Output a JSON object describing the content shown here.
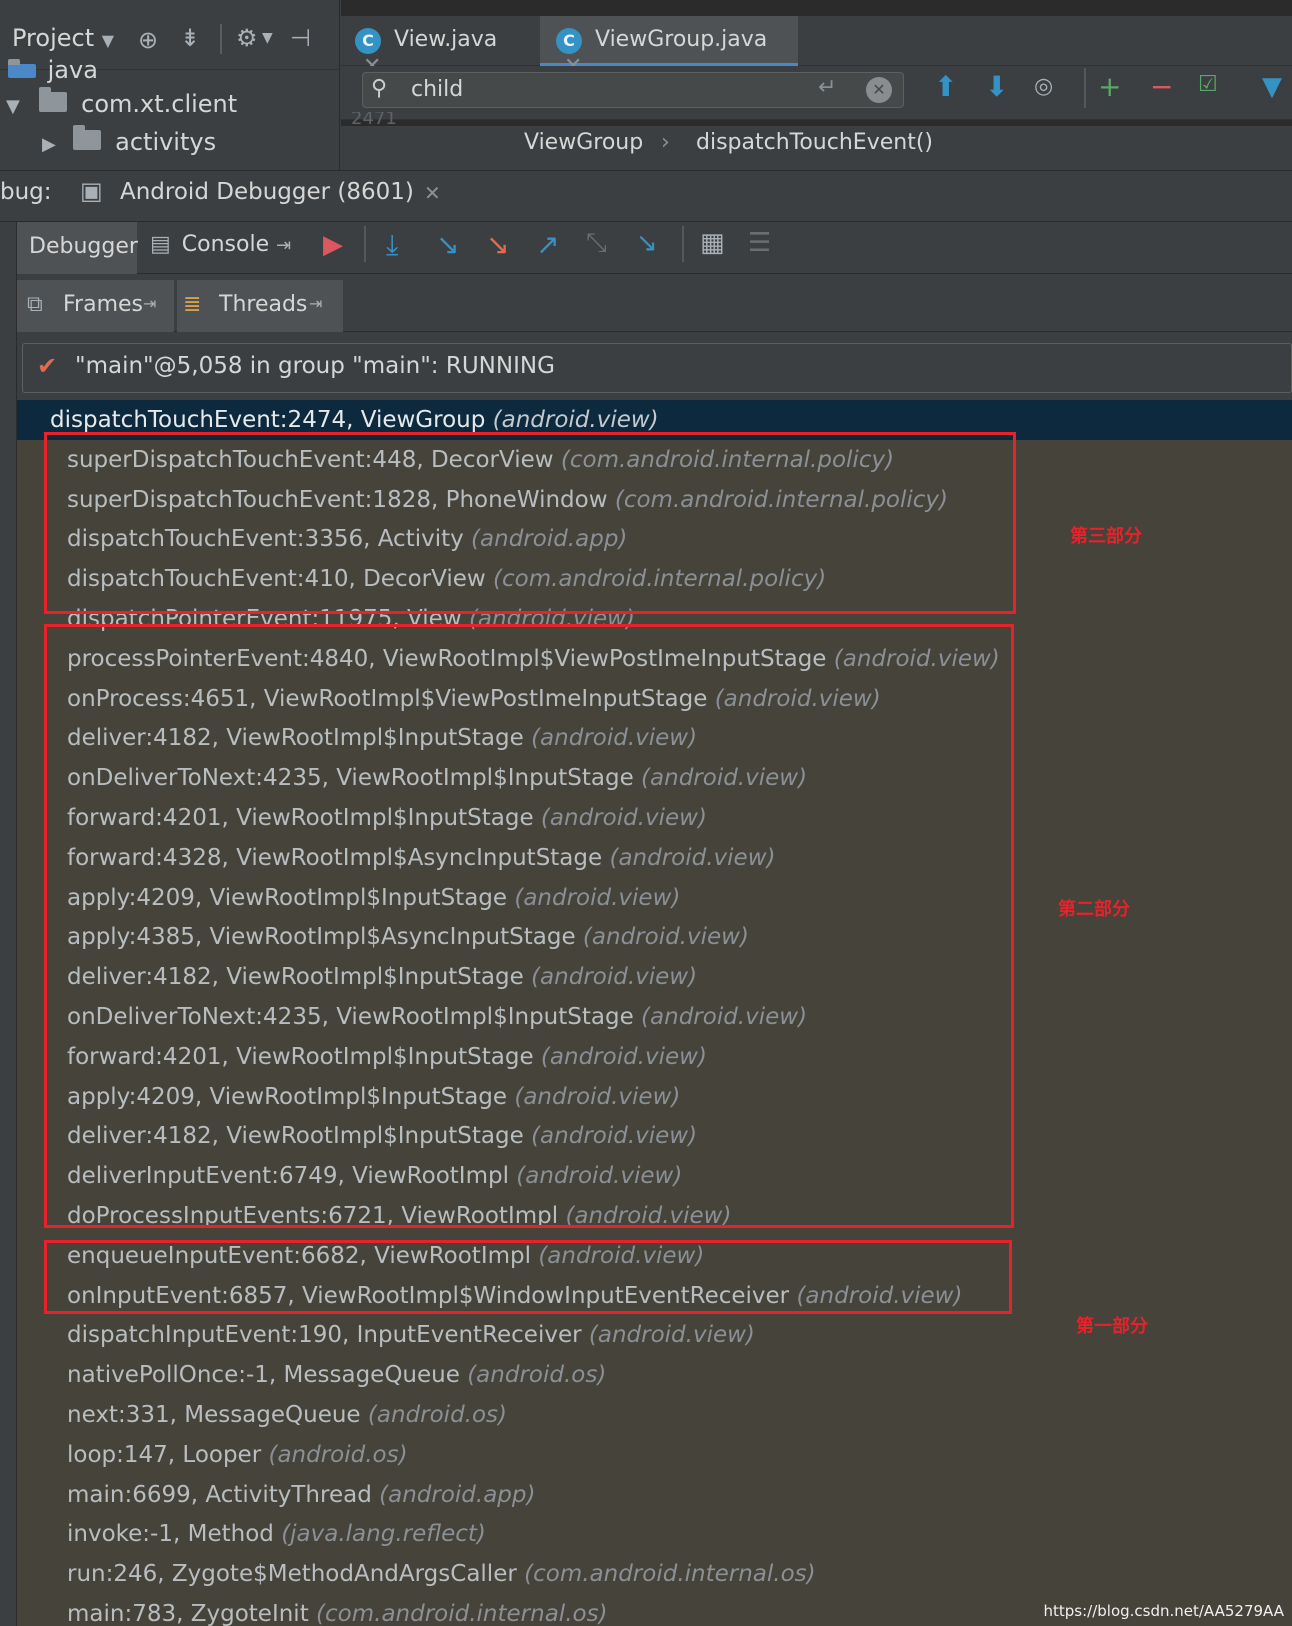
{
  "project_panel": {
    "title": "Project",
    "tree": [
      {
        "label": "java"
      },
      {
        "label": "com.xt.client"
      },
      {
        "label": "activitys"
      }
    ]
  },
  "editor": {
    "tabs": [
      {
        "label": "View.java",
        "icon": "C"
      },
      {
        "label": "ViewGroup.java",
        "icon": "C"
      }
    ],
    "search": {
      "value": "child"
    },
    "breadcrumbs": [
      "ViewGroup",
      "dispatchTouchEvent()"
    ],
    "gutter_fragment": "2471"
  },
  "debug": {
    "window_label": "bug:",
    "session_title": "Android Debugger (8601)",
    "tabs": {
      "debugger": "Debugger",
      "console": "Console"
    },
    "subtabs": {
      "frames": "Frames",
      "threads": "Threads"
    },
    "thread": "\"main\"@5,058 in group \"main\": RUNNING",
    "frames": [
      {
        "method": "dispatchTouchEvent:2474, ViewGroup",
        "pkg": "(android.view)",
        "selected": true
      },
      {
        "method": "superDispatchTouchEvent:448, DecorView",
        "pkg": "(com.android.internal.policy)"
      },
      {
        "method": "superDispatchTouchEvent:1828, PhoneWindow",
        "pkg": "(com.android.internal.policy)"
      },
      {
        "method": "dispatchTouchEvent:3356, Activity",
        "pkg": "(android.app)"
      },
      {
        "method": "dispatchTouchEvent:410, DecorView",
        "pkg": "(com.android.internal.policy)"
      },
      {
        "method": "dispatchPointerEvent:11975, View",
        "pkg": "(android.view)"
      },
      {
        "method": "processPointerEvent:4840, ViewRootImpl$ViewPostImeInputStage",
        "pkg": "(android.view)"
      },
      {
        "method": "onProcess:4651, ViewRootImpl$ViewPostImeInputStage",
        "pkg": "(android.view)"
      },
      {
        "method": "deliver:4182, ViewRootImpl$InputStage",
        "pkg": "(android.view)"
      },
      {
        "method": "onDeliverToNext:4235, ViewRootImpl$InputStage",
        "pkg": "(android.view)"
      },
      {
        "method": "forward:4201, ViewRootImpl$InputStage",
        "pkg": "(android.view)"
      },
      {
        "method": "forward:4328, ViewRootImpl$AsyncInputStage",
        "pkg": "(android.view)"
      },
      {
        "method": "apply:4209, ViewRootImpl$InputStage",
        "pkg": "(android.view)"
      },
      {
        "method": "apply:4385, ViewRootImpl$AsyncInputStage",
        "pkg": "(android.view)"
      },
      {
        "method": "deliver:4182, ViewRootImpl$InputStage",
        "pkg": "(android.view)"
      },
      {
        "method": "onDeliverToNext:4235, ViewRootImpl$InputStage",
        "pkg": "(android.view)"
      },
      {
        "method": "forward:4201, ViewRootImpl$InputStage",
        "pkg": "(android.view)"
      },
      {
        "method": "apply:4209, ViewRootImpl$InputStage",
        "pkg": "(android.view)"
      },
      {
        "method": "deliver:4182, ViewRootImpl$InputStage",
        "pkg": "(android.view)"
      },
      {
        "method": "deliverInputEvent:6749, ViewRootImpl",
        "pkg": "(android.view)"
      },
      {
        "method": "doProcessInputEvents:6721, ViewRootImpl",
        "pkg": "(android.view)"
      },
      {
        "method": "enqueueInputEvent:6682, ViewRootImpl",
        "pkg": "(android.view)"
      },
      {
        "method": "onInputEvent:6857, ViewRootImpl$WindowInputEventReceiver",
        "pkg": "(android.view)"
      },
      {
        "method": "dispatchInputEvent:190, InputEventReceiver",
        "pkg": "(android.view)"
      },
      {
        "method": "nativePollOnce:-1, MessageQueue",
        "pkg": "(android.os)"
      },
      {
        "method": "next:331, MessageQueue",
        "pkg": "(android.os)"
      },
      {
        "method": "loop:147, Looper",
        "pkg": "(android.os)"
      },
      {
        "method": "main:6699, ActivityThread",
        "pkg": "(android.app)"
      },
      {
        "method": "invoke:-1, Method",
        "pkg": "(java.lang.reflect)"
      },
      {
        "method": "run:246, Zygote$MethodAndArgsCaller",
        "pkg": "(com.android.internal.os)"
      },
      {
        "method": "main:783, ZygoteInit",
        "pkg": "(com.android.internal.os)"
      }
    ]
  },
  "annotations": {
    "part3": "第三部分",
    "part2": "第二部分",
    "part1": "第一部分",
    "color": "#e8222a"
  },
  "watermark": "https://blog.csdn.net/AA5279AA"
}
